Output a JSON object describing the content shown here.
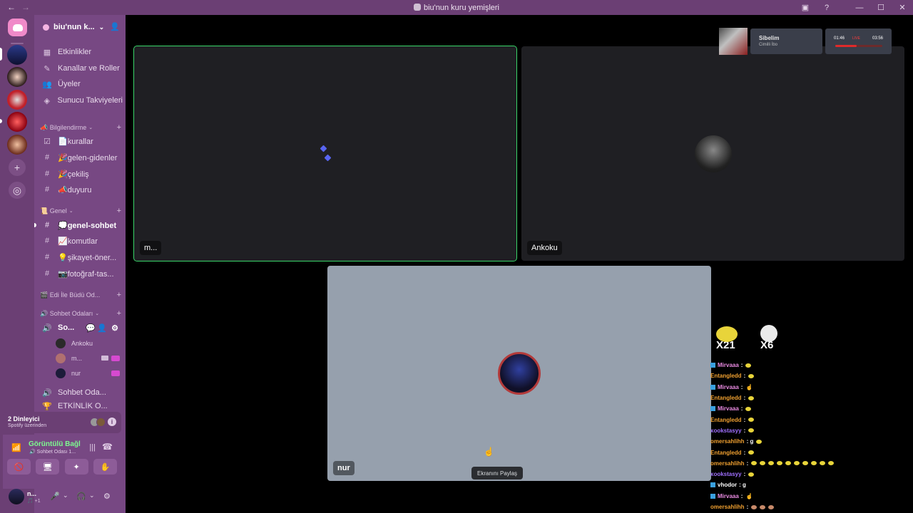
{
  "window": {
    "title": "biu'nun kuru yemişleri",
    "nav_back": "←",
    "nav_forward": "→",
    "inbox_icon": "▣",
    "help_icon": "?",
    "minimize": "—",
    "maximize": "☐",
    "close": "✕"
  },
  "rail": {
    "add_icon": "+",
    "discover_icon": "◎"
  },
  "server": {
    "name": "biu'nun k...",
    "chevron": "⌄",
    "invite_icon": "👤",
    "top_items": [
      {
        "icon": "▦",
        "label": "Etkinlikler"
      },
      {
        "icon": "✎",
        "label": "Kanallar ve Roller"
      },
      {
        "icon": "👥",
        "label": "Üyeler"
      },
      {
        "icon": "◈",
        "label": "Sunucu Takviyeleri"
      }
    ],
    "categories": {
      "bilgilendirme": "📣 Bilgilendirme",
      "genel": "📜 Genel",
      "edi": "🎬 Edi İle Büdü Od...",
      "sohbet": "🔊 Sohbet Odaları"
    },
    "bilgilendirme_channels": [
      {
        "icon": "☑",
        "label": "📄kurallar"
      },
      {
        "icon": "#",
        "label": "🎉gelen-gidenler"
      },
      {
        "icon": "#",
        "label": "🎉çekiliş"
      },
      {
        "icon": "#",
        "label": "📣duyuru"
      }
    ],
    "genel_channels": [
      {
        "icon": "#",
        "label": "💭genel-sohbet",
        "active": true
      },
      {
        "icon": "#",
        "label": "📈komutlar"
      },
      {
        "icon": "#",
        "label": "💡şikayet-öner..."
      },
      {
        "icon": "#",
        "label": "📷fotoğraf-tas..."
      }
    ],
    "voice_channel": {
      "icon": "🔊",
      "label": "So...",
      "chat_icon": "💬",
      "invite_icon": "👤",
      "settings_icon": "⚙"
    },
    "voice_users": [
      {
        "name": "Ankoku",
        "avatar_color": "#2a2a2a"
      },
      {
        "name": "m...",
        "avatar_color": "#b07070"
      },
      {
        "name": "nur",
        "avatar_color": "#1c1c3a"
      }
    ],
    "more_channels": [
      {
        "icon": "🔊",
        "label": "Sohbet Oda..."
      },
      {
        "icon": "🏆",
        "label": "ETKİNLİK O..."
      }
    ],
    "plus": "+"
  },
  "listening": {
    "title": "2 Dinleyici",
    "subtitle": "Spotify üzerinden",
    "info_icon": "i"
  },
  "connection": {
    "status": "Görüntülü Bağl",
    "channel": "🔊 Sohbet Odası 1...",
    "signal_icon": "📶",
    "noise_icon": "|||",
    "disconnect_icon": "☎",
    "buttons": [
      "🚫",
      "🖥",
      "✦",
      "✋"
    ]
  },
  "user": {
    "name": "n...",
    "status": "🎵 +1",
    "mic_icon": "🎤",
    "headset_icon": "🎧",
    "settings_icon": "⚙",
    "chev": "⌄"
  },
  "tiles": [
    {
      "name": "m...",
      "speaking": true
    },
    {
      "name": "Ankoku",
      "speaking": false
    },
    {
      "name": "nur",
      "speaking": false
    }
  ],
  "share_tooltip": "Ekranını Paylaş",
  "cursor_icon": "☝",
  "now_playing": {
    "song": "Sibelim",
    "artist": "Cimilli İbo",
    "elapsed": "01:46",
    "total": "03:56",
    "live": "LIVE",
    "progress": 0.45,
    "accent": "#e02a2a"
  },
  "emotes": [
    {
      "label": "X21"
    },
    {
      "label": "X6"
    }
  ],
  "chat": [
    {
      "user": "Mirvaaa",
      "color": "#e88ae0",
      "badge": true,
      "text": ":",
      "content": "emote"
    },
    {
      "user": "Entangledd",
      "color": "#f0a030",
      "badge": false,
      "text": ":",
      "content": "emote"
    },
    {
      "user": "Mirvaaa",
      "color": "#e88ae0",
      "badge": true,
      "text": ":",
      "content": "hand"
    },
    {
      "user": "Entangledd",
      "color": "#f0a030",
      "badge": false,
      "text": ":",
      "content": "emote"
    },
    {
      "user": "Mirvaaa",
      "color": "#e88ae0",
      "badge": true,
      "text": ":",
      "content": "emote"
    },
    {
      "user": "Entangledd",
      "color": "#f0a030",
      "badge": false,
      "text": ":",
      "content": "emote"
    },
    {
      "user": "xookstasyy",
      "color": "#a070ff",
      "badge": false,
      "text": ":",
      "content": "emote"
    },
    {
      "user": "omersahlihh",
      "color": "#f0a030",
      "badge": false,
      "text": ": g",
      "content": "emote"
    },
    {
      "user": "Entangledd",
      "color": "#f0a030",
      "badge": false,
      "text": ":",
      "content": "emote"
    },
    {
      "user": "omersahlihh",
      "color": "#f0a030",
      "badge": false,
      "text": ":",
      "content": "emote10"
    },
    {
      "user": "xookstasyy",
      "color": "#a070ff",
      "badge": false,
      "text": ":",
      "content": "emote"
    },
    {
      "user": "vhodor",
      "color": "#ffffff",
      "badge": true,
      "text": ": g",
      "content": "none"
    },
    {
      "user": "Mirvaaa",
      "color": "#e88ae0",
      "badge": true,
      "text": ":",
      "content": "hand"
    },
    {
      "user": "omersahlihh",
      "color": "#f0a030",
      "badge": false,
      "text": ":",
      "content": "emote3"
    }
  ]
}
